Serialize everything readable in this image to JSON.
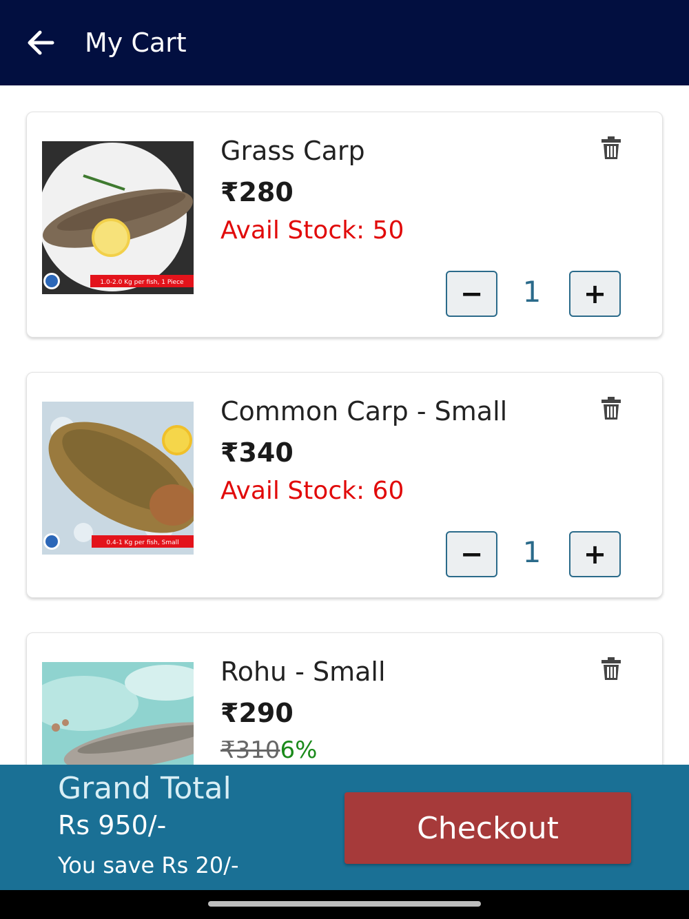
{
  "header": {
    "title": "My Cart",
    "back_icon": "arrow-left-icon",
    "background": "#020f40"
  },
  "cart": {
    "items": [
      {
        "name": "Grass Carp",
        "price": "₹280",
        "stock": "Avail Stock: 50",
        "quantity": "1",
        "image_caption": "1.0-2.0 Kg per fish, 1 Piece"
      },
      {
        "name": "Common Carp - Small",
        "price": "₹340",
        "stock": "Avail Stock: 60",
        "quantity": "1",
        "image_caption": "0.4-1 Kg per fish, Small"
      },
      {
        "name": "Rohu - Small",
        "price": "₹290",
        "old_price": "₹310",
        "discount": "6%"
      }
    ],
    "minus_label": "−",
    "plus_label": "+"
  },
  "footer": {
    "grand_total_label": "Grand Total",
    "grand_total_value": "Rs 950/-",
    "savings": "You save Rs 20/-",
    "checkout_label": "Checkout",
    "background": "#1a7095",
    "checkout_color": "#a63a3a"
  },
  "icons": {
    "delete": "trash-icon",
    "back": "arrow-left-icon"
  }
}
